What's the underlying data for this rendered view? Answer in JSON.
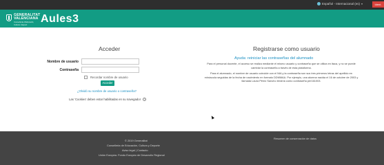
{
  "topbar": {
    "language": "Español - Internacional (es)",
    "login_button": "Ident."
  },
  "header": {
    "gen_line1": "GENERALITAT",
    "gen_line2": "VALENCIANA",
    "gen_sub1": "Conselleria d'Educació,",
    "gen_sub2": "Cultura i Esport",
    "brand": "Aules3"
  },
  "login": {
    "title": "Acceder",
    "username_label": "Nombre de usuario",
    "password_label": "Contraseña",
    "username_value": "",
    "password_value": "",
    "remember_label": "Recordar nombre de usuario",
    "submit_label": "Acceder",
    "forgot_link": "¿Olvidó su nombre de usuario o contraseña?",
    "cookies_notice": "Las 'Cookies' deben estar habilitadas en su navegador"
  },
  "register": {
    "title": "Registrarse como usuario",
    "help_title": "Ayuda: reiniciar las contraseñas del alumnado",
    "para1_line1": "Para el personal docente, el acceso se realiza mediante el mismo usuario y contraseña que se utiliza en itaca, y no se puede",
    "para1_line2": "cambiar la contraseña a través de esta plataforma.",
    "para2_line1": "Para el alumnado, el nombre de usuario coincide con el NIA y la contraseña son sus tres primeros letras del apellido en",
    "para2_line2": "minúscula seguidas de la fecha de nacimiento en formato DDMMAA. Por ejemplo, una alumna nacida el 16 de octubre de 2003 y",
    "para2_line3": "llamada Laura Pérez Sancho tendría como contraseña per161003."
  },
  "footer": {
    "copyright": "© 2019 Generalitat",
    "conselleria": "Conselleria de Educación, Cultura y Deporte",
    "aviso": "Aviso legal | Contacto",
    "eu": "Unión Europea. Fondo Europeo de Desarrollo Regional",
    "retention": "Resumen de conservación de datos"
  }
}
